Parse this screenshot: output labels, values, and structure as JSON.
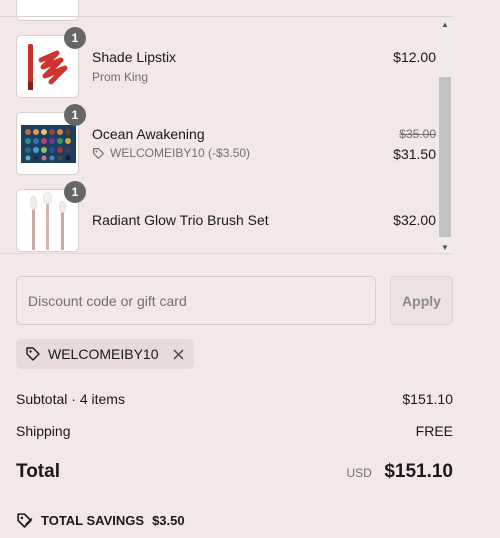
{
  "cart": {
    "items": [
      {
        "name": "Shade Lipstix",
        "variant": "Prom King",
        "quantity": "1",
        "price": "$12.00",
        "thumbnail_icon": "lipstick-image"
      },
      {
        "name": "Ocean Awakening",
        "discount_code": "WELCOMEIBY10 (-$3.50)",
        "quantity": "1",
        "original_price": "$35.00",
        "price": "$31.50",
        "thumbnail_icon": "eyeshadow-palette-image"
      },
      {
        "name": "Radiant Glow Trio Brush Set",
        "quantity": "1",
        "price": "$32.00",
        "thumbnail_icon": "brush-set-image"
      }
    ]
  },
  "discount": {
    "placeholder": "Discount code or gift card",
    "value": "",
    "apply_label": "Apply",
    "applied_code": "WELCOMEIBY10"
  },
  "summary": {
    "subtotal_label": "Subtotal · 4 items",
    "subtotal_value": "$151.10",
    "shipping_label": "Shipping",
    "shipping_value": "FREE",
    "total_label": "Total",
    "currency": "USD",
    "total_value": "$151.10",
    "savings_label": "TOTAL SAVINGS",
    "savings_value": "$3.50"
  },
  "colors": {
    "background": "#f3e7e8",
    "chip_background": "#e8dadb",
    "badge": "#666666",
    "muted_text": "#707070"
  }
}
